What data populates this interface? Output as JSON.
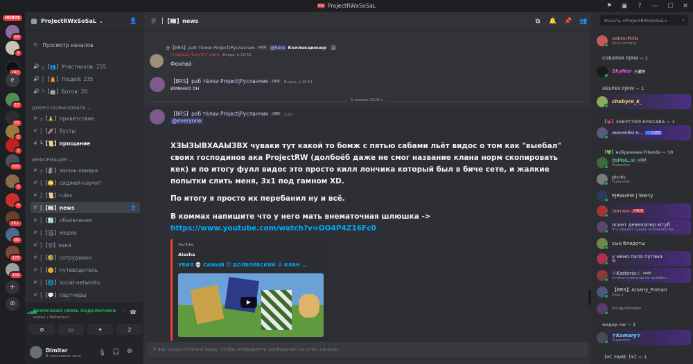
{
  "window": {
    "title": "ProJectRWxSoSaL"
  },
  "rail": {
    "new_label": "НОВОЕ",
    "badges": [
      "64",
      "2",
      "167",
      "17",
      "72",
      "2",
      "1",
      "293",
      "2",
      "3",
      "1K+",
      "80",
      "179",
      "158"
    ]
  },
  "server": {
    "name": "ProJectRWxSoSaL"
  },
  "sidebar": {
    "browse": "Просмотр каналов",
    "stats": [
      "┌【👥】Участников: 255",
      "│【🙎】Людей: 235",
      "└【🤖】Ботов: 20"
    ],
    "cat_welcome": "ДОБРО ПОЖАЛОВАТЬ",
    "welcome_channels": [
      "┌【🙏】приветствие",
      "│【🚀】бусты",
      "└【📜】прощание"
    ],
    "cat_info": "ИНФОРМАЦИЯ",
    "info_channels": [
      "┌【🗿】жизнь-овнера",
      "│【🙄】сиджей-научит",
      "│【📜】rules",
      "│【📰】news",
      "│【🔄】обновления",
      "│【🗒】медиа",
      "│【😡】кеки",
      "│【🤣】сотрудники",
      "│【🧐】путеводитель",
      "│【🌐】social-networks",
      "│【💬】партнеры"
    ]
  },
  "voice": {
    "status": "Голосовая связь подключена",
    "channel": "voice1 / Morentecz"
  },
  "user": {
    "name": "Dimitar",
    "status": "В голосовом чате"
  },
  "chat": {
    "channel": "│【📰】news",
    "reply_line": "@【BRS】раб тёлки Project|Русланчик",
    "reply_tag": "⚡XIV",
    "reply_mention": "@here",
    "reply_text": "Коллекционер",
    "system": "главный покупст сокм",
    "system_time": "Вчера, в 10:51",
    "msg1_text": "Фонпей",
    "msg2_author": "【BRS】раб тёлки Project|Русланчик",
    "msg2_tag": "⚡XIV",
    "msg2_time": "Вчера, в 10:51",
    "msg2_text": "именно он",
    "date_divider": "1 января 2026 г.",
    "msg3_author": "【BRS】раб тёлки Project|Русланчик",
    "msg3_tag": "⚡XIV",
    "msg3_time": "2:27",
    "msg3_mention": "@everyone",
    "p1": "ХЗЫЗЫВХААЫЗВХ чуваки тут какой то бомж с пятью сабами льёт видос о том как \"выебал\" своих господинов ака ProjectRW (долбоёб даже не смог название клана норм скопировать кек) и по итогу фулл видос это просто килл лончика который был в биче сете, и жалкие попытки слить меня, 3x1 под гамном XD.",
    "p2": "По итогу я просто их перебанил ну и всё.",
    "p3_text": "В коммах напишите что у него мать внематочная шлюшка -> ",
    "p3_link": "https://www.youtube.com/watch?v=OO4P4Z16Fc0",
    "embed": {
      "provider": "YouTube",
      "author": "Alezha",
      "title": "УБИЛ 💀 САМЫЙ 😈 ДОЛБОЁБСКИЙ 😵 КЛАН ..."
    },
    "input_placeholder": "У вас недостаточно прав, чтобы отправлять сообщения на этом канале."
  },
  "members": {
    "search_placeholder": "Искать «ProJectRWxSoSaL»",
    "top": {
      "name": "vektorPON",
      "sub": "Хочу котлету"
    },
    "cat_curator": "CURATOR PJRW — 1",
    "curator": {
      "name": "SkyNer",
      "tag": "☀星月"
    },
    "cat_helper": "HELPER PJRW — 1",
    "helper": {
      "name": "chebyre_k_"
    },
    "cat_club": "【💗】ЗАБУСТИЛ КРАСАВА — 1",
    "club": {
      "name": "никнейм н...",
      "tag": "🔷CODE"
    },
    "cat_friends": "【💚】избранные-friends — 10",
    "friends": [
      {
        "name": "ItsMaiL.ai",
        "tag": "⚡XIV",
        "sub": "TLauncher"
      },
      {
        "name": "picnic",
        "sub": "TLauncher"
      },
      {
        "name": "PJRWxFM | Werty"
      },
      {
        "name": "лончик",
        "tag": "⚡NUR"
      },
      {
        "name": "осинт девелопер ютуб",
        "sub": "Что вершит судьбу человечества..."
      },
      {
        "name": "сын блядоты"
      },
      {
        "name": "у меня папа путана",
        "sub": "💜"
      },
      {
        "name": "☆Kastoria☆",
        "tag": "cute",
        "sub": "я никого никогда не полюбит..."
      },
      {
        "name": "【BRS】Arseny_Foman",
        "sub": "Dota 2"
      },
      {
        "name": "",
        "sub": "dsc.gg/offshades"
      }
    ],
    "cat_moder": "модер кw — 1",
    "moder": {
      "name": "✲Komary✲",
      "sub": "TLauncher"
    },
    "cat_fame": "【❤】FAME【❤】— 1"
  }
}
